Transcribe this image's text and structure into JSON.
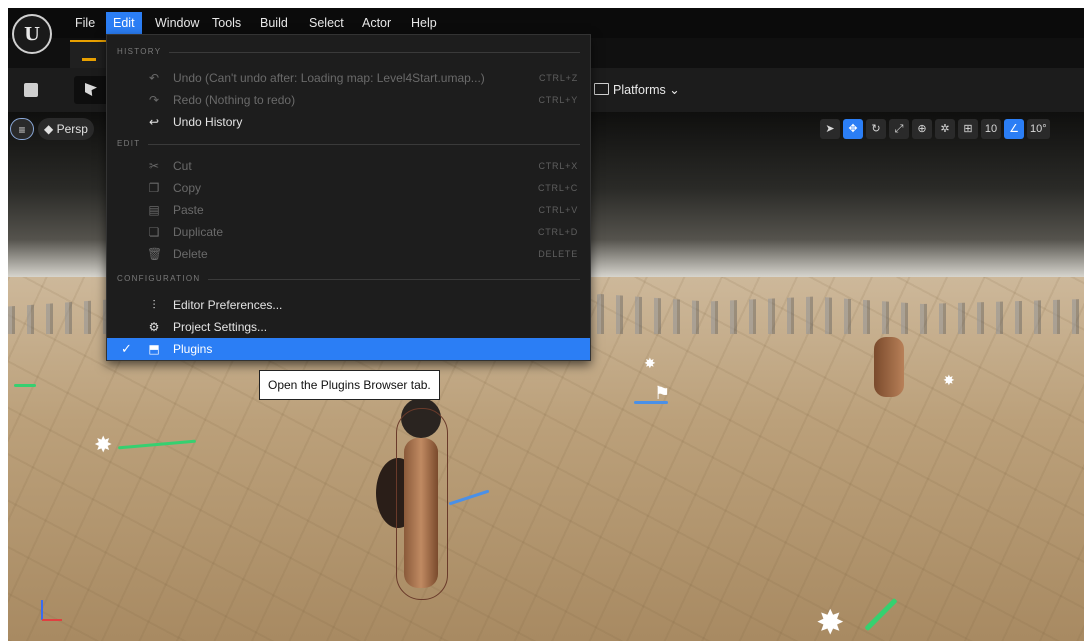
{
  "menubar": [
    "File",
    "Edit",
    "Window",
    "Tools",
    "Build",
    "Select",
    "Actor",
    "Help"
  ],
  "active_menu": "Edit",
  "toolbar": {
    "platforms_label": "Platforms",
    "platforms_chevron": "⌄"
  },
  "viewport": {
    "menu_icon": "≡",
    "perspective_label": "Persp",
    "grid_snap": "10",
    "rotation_snap": "10°"
  },
  "edit_menu": {
    "sections": {
      "history": "HISTORY",
      "edit": "EDIT",
      "configuration": "CONFIGURATION"
    },
    "items": [
      {
        "label": "Undo (Can't undo after: Loading map: Level4Start.umap...)",
        "shortcut": "CTRL+Z",
        "enabled": false,
        "icon": "undo-icon"
      },
      {
        "label": "Redo (Nothing to redo)",
        "shortcut": "CTRL+Y",
        "enabled": false,
        "icon": "redo-icon"
      },
      {
        "label": "Undo History",
        "shortcut": "",
        "enabled": true,
        "icon": "undo-history-icon"
      },
      {
        "label": "Cut",
        "shortcut": "CTRL+X",
        "enabled": false,
        "icon": "cut-icon"
      },
      {
        "label": "Copy",
        "shortcut": "CTRL+C",
        "enabled": false,
        "icon": "copy-icon"
      },
      {
        "label": "Paste",
        "shortcut": "CTRL+V",
        "enabled": false,
        "icon": "paste-icon"
      },
      {
        "label": "Duplicate",
        "shortcut": "CTRL+D",
        "enabled": false,
        "icon": "duplicate-icon"
      },
      {
        "label": "Delete",
        "shortcut": "DELETE",
        "enabled": false,
        "icon": "delete-icon"
      },
      {
        "label": "Editor Preferences...",
        "shortcut": "",
        "enabled": true,
        "icon": "sliders-icon"
      },
      {
        "label": "Project Settings...",
        "shortcut": "",
        "enabled": true,
        "icon": "settings-icon"
      },
      {
        "label": "Plugins",
        "shortcut": "",
        "enabled": true,
        "selected": true,
        "icon": "plugin-icon"
      }
    ]
  },
  "tooltip": "Open the Plugins Browser tab.",
  "colors": {
    "accent": "#2b7ef5",
    "menu_bg": "#1d1d1d",
    "level_tab_accent": "#e8a000"
  }
}
